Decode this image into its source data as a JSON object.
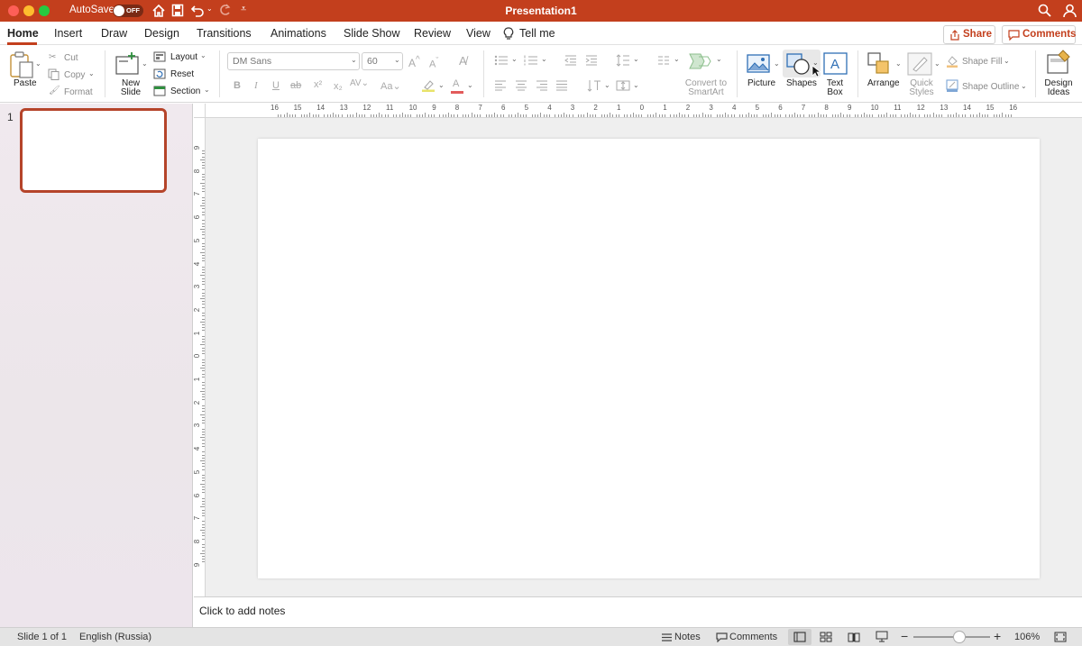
{
  "window": {
    "title": "Presentation1",
    "autosave_label": "AutoSave",
    "autosave_state": "OFF"
  },
  "tabs": [
    {
      "label": "Home",
      "active": true
    },
    {
      "label": "Insert"
    },
    {
      "label": "Draw"
    },
    {
      "label": "Design"
    },
    {
      "label": "Transitions"
    },
    {
      "label": "Animations"
    },
    {
      "label": "Slide Show"
    },
    {
      "label": "Review"
    },
    {
      "label": "View"
    },
    {
      "label": "Tell me"
    }
  ],
  "top_buttons": {
    "share": "Share",
    "comments": "Comments"
  },
  "ribbon": {
    "paste": "Paste",
    "cut": "Cut",
    "copy": "Copy",
    "format": "Format",
    "new_slide_1": "New",
    "new_slide_2": "Slide",
    "layout": "Layout",
    "reset": "Reset",
    "section": "Section",
    "font_name": "DM Sans",
    "font_size": "60",
    "convert_1": "Convert to",
    "convert_2": "SmartArt",
    "picture": "Picture",
    "shapes": "Shapes",
    "textbox_1": "Text",
    "textbox_2": "Box",
    "arrange": "Arrange",
    "quick_styles_1": "Quick",
    "quick_styles_2": "Styles",
    "shape_fill": "Shape Fill",
    "shape_outline": "Shape Outline",
    "design_ideas_1": "Design",
    "design_ideas_2": "Ideas"
  },
  "ruler": {
    "h_labels": [
      "16",
      "15",
      "14",
      "13",
      "12",
      "11",
      "10",
      "9",
      "8",
      "7",
      "6",
      "5",
      "4",
      "3",
      "2",
      "1",
      "0",
      "1",
      "2",
      "3",
      "4",
      "5",
      "6",
      "7",
      "8",
      "9",
      "10",
      "11",
      "12",
      "13",
      "14",
      "15",
      "16"
    ],
    "v_labels": [
      "9",
      "8",
      "7",
      "6",
      "5",
      "4",
      "3",
      "2",
      "1",
      "0",
      "1",
      "2",
      "3",
      "4",
      "5",
      "6",
      "7",
      "8",
      "9"
    ]
  },
  "thumbnails": [
    {
      "number": "1"
    }
  ],
  "notes": {
    "placeholder": "Click to add notes"
  },
  "status": {
    "slide_info": "Slide 1 of 1",
    "language": "English (Russia)",
    "notes": "Notes",
    "comments": "Comments",
    "zoom_percent": "106%",
    "zoom_level": 0.6
  },
  "colors": {
    "accent": "#c33f1d",
    "selected_thumb_border": "#b5442a",
    "icon_blue": "#2f6fb5"
  }
}
